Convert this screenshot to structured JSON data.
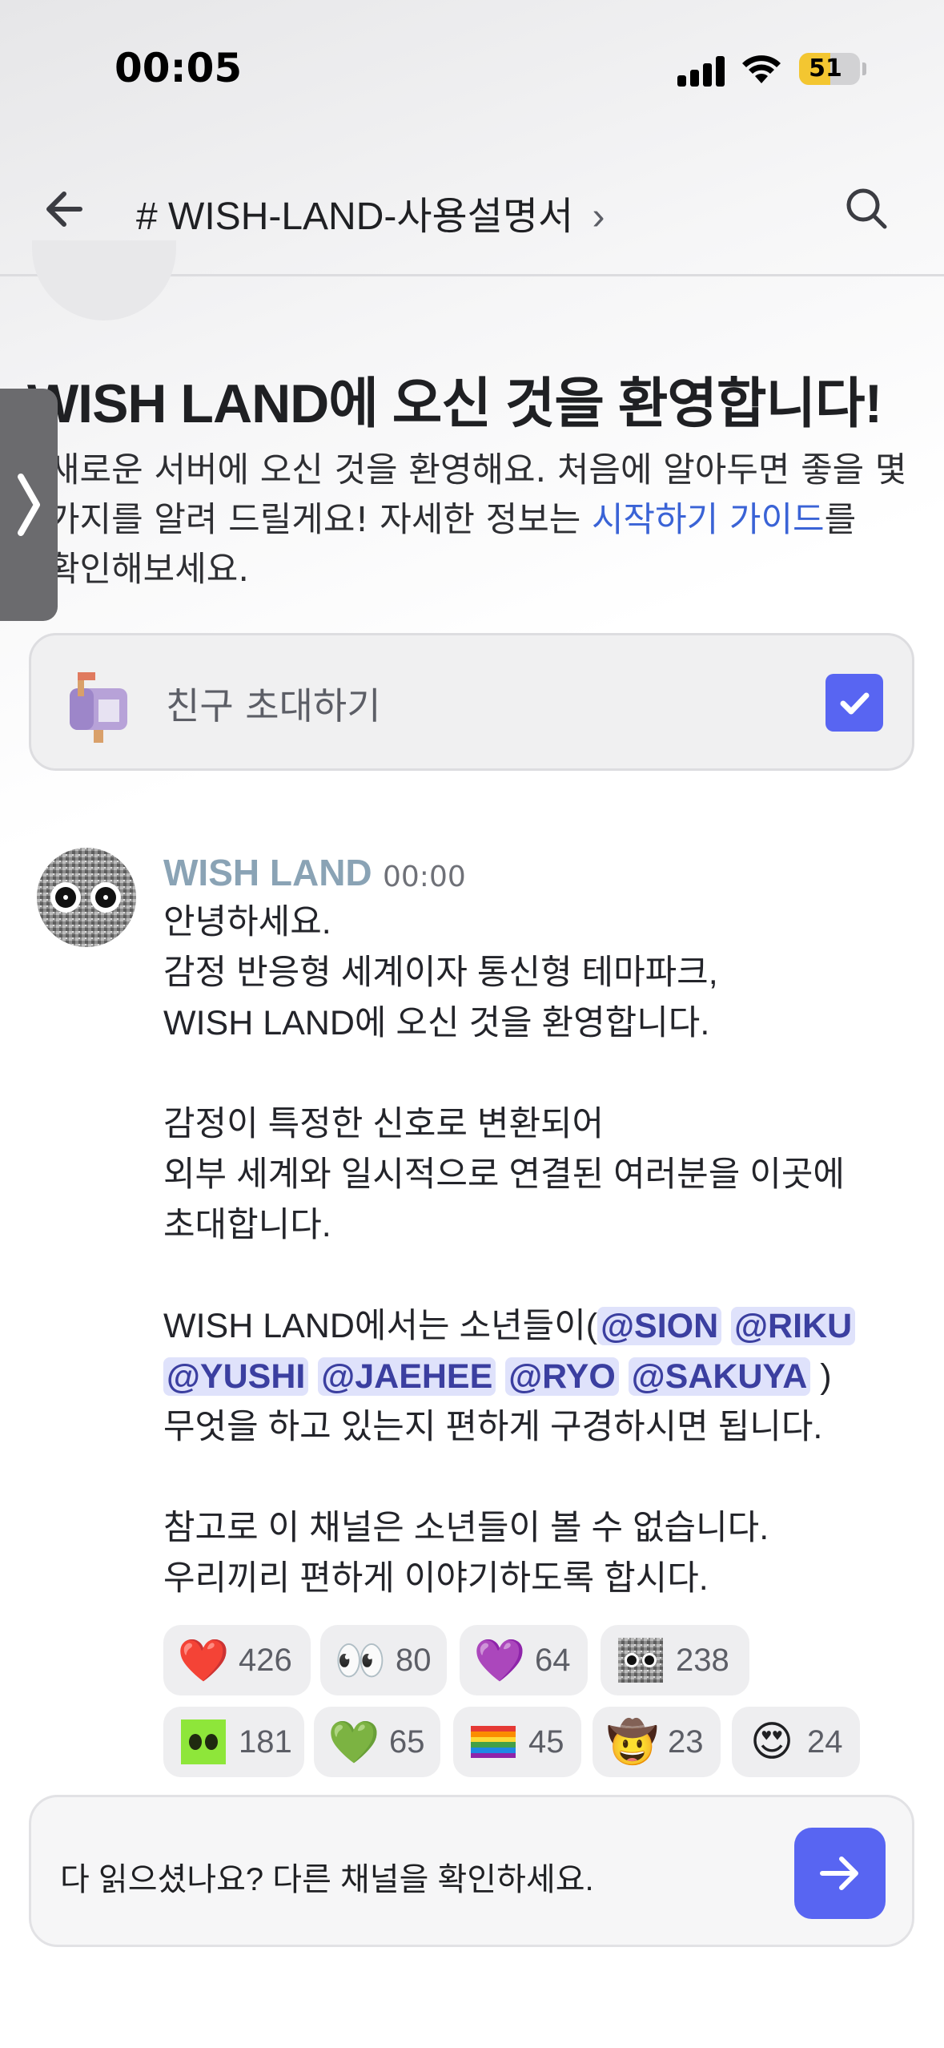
{
  "status_bar": {
    "time": "00:05",
    "battery": "51",
    "battery_level": 0.51
  },
  "header": {
    "channel": "# WISH-LAND-사용설명서",
    "chevron": "›"
  },
  "welcome": {
    "title": "WISH LAND에 오신 것을 환영합니다!",
    "desc_line1": "새로운 서버에 오신 것을 환영해요. 처음에 알아두면 좋을 몇",
    "desc_line2_a": "가지를 알려   드릴게요! 자세한 정보는 ",
    "desc_link": "시작하기 가이드",
    "desc_line2_b": "를",
    "desc_line3": "확인해보세요."
  },
  "checklist": {
    "label": "친구 초대하기",
    "checked": true
  },
  "message": {
    "author": "WISH LAND",
    "time": "00:00",
    "lines": [
      "안녕하세요.",
      "감정 반응형 세계이자 통신형 테마파크,",
      "WISH LAND에 오신 것을 환영합니다.",
      "",
      "감정이 특정한 신호로 변환되어",
      "외부 세계와 일시적으로 연결된 여러분을 이곳에",
      "초대합니다.",
      ""
    ],
    "mention_intro": "WISH LAND에서는 소년들이(",
    "mentions": [
      "@SION",
      "@RIKU",
      "@YUSHI",
      "@JAEHEE",
      "@RYO",
      "@SAKUYA"
    ],
    "mention_close": ")",
    "after_lines": [
      "무엇을 하고 있는지 편하게 구경하시면 됩니다.",
      "",
      "참고로 이 채널은 소년들이 볼 수 없습니다.",
      "우리끼리 편하게 이야기하도록 합시다."
    ]
  },
  "reactions": [
    {
      "emoji": "❤️",
      "icon": "red-heart-icon",
      "count": "426"
    },
    {
      "emoji": "👀",
      "icon": "eyes-icon",
      "count": "80"
    },
    {
      "emoji": "💜",
      "icon": "purple-heart-icon",
      "count": "64"
    },
    {
      "emoji": "",
      "icon": "custom-eyes-noise-icon",
      "count": "238"
    },
    {
      "emoji": "",
      "icon": "custom-green-eyes-icon",
      "count": "181"
    },
    {
      "emoji": "💚",
      "icon": "green-heart-icon",
      "count": "65"
    },
    {
      "emoji": "🏳️‍🌈",
      "icon": "rainbow-flag-icon",
      "count": "45"
    },
    {
      "emoji": "🤠",
      "icon": "cowboy-face-icon",
      "count": "23"
    },
    {
      "emoji": "😍",
      "icon": "heart-eyes-icon",
      "count": "24"
    }
  ],
  "bottom": {
    "prompt": "다 읽으셨나요? 다른 채널을 확인하세요."
  },
  "colors": {
    "accent": "#5865f2",
    "link": "#3a63d6",
    "author": "#8aa3b5",
    "mention_bg": "#dfe2fb"
  }
}
